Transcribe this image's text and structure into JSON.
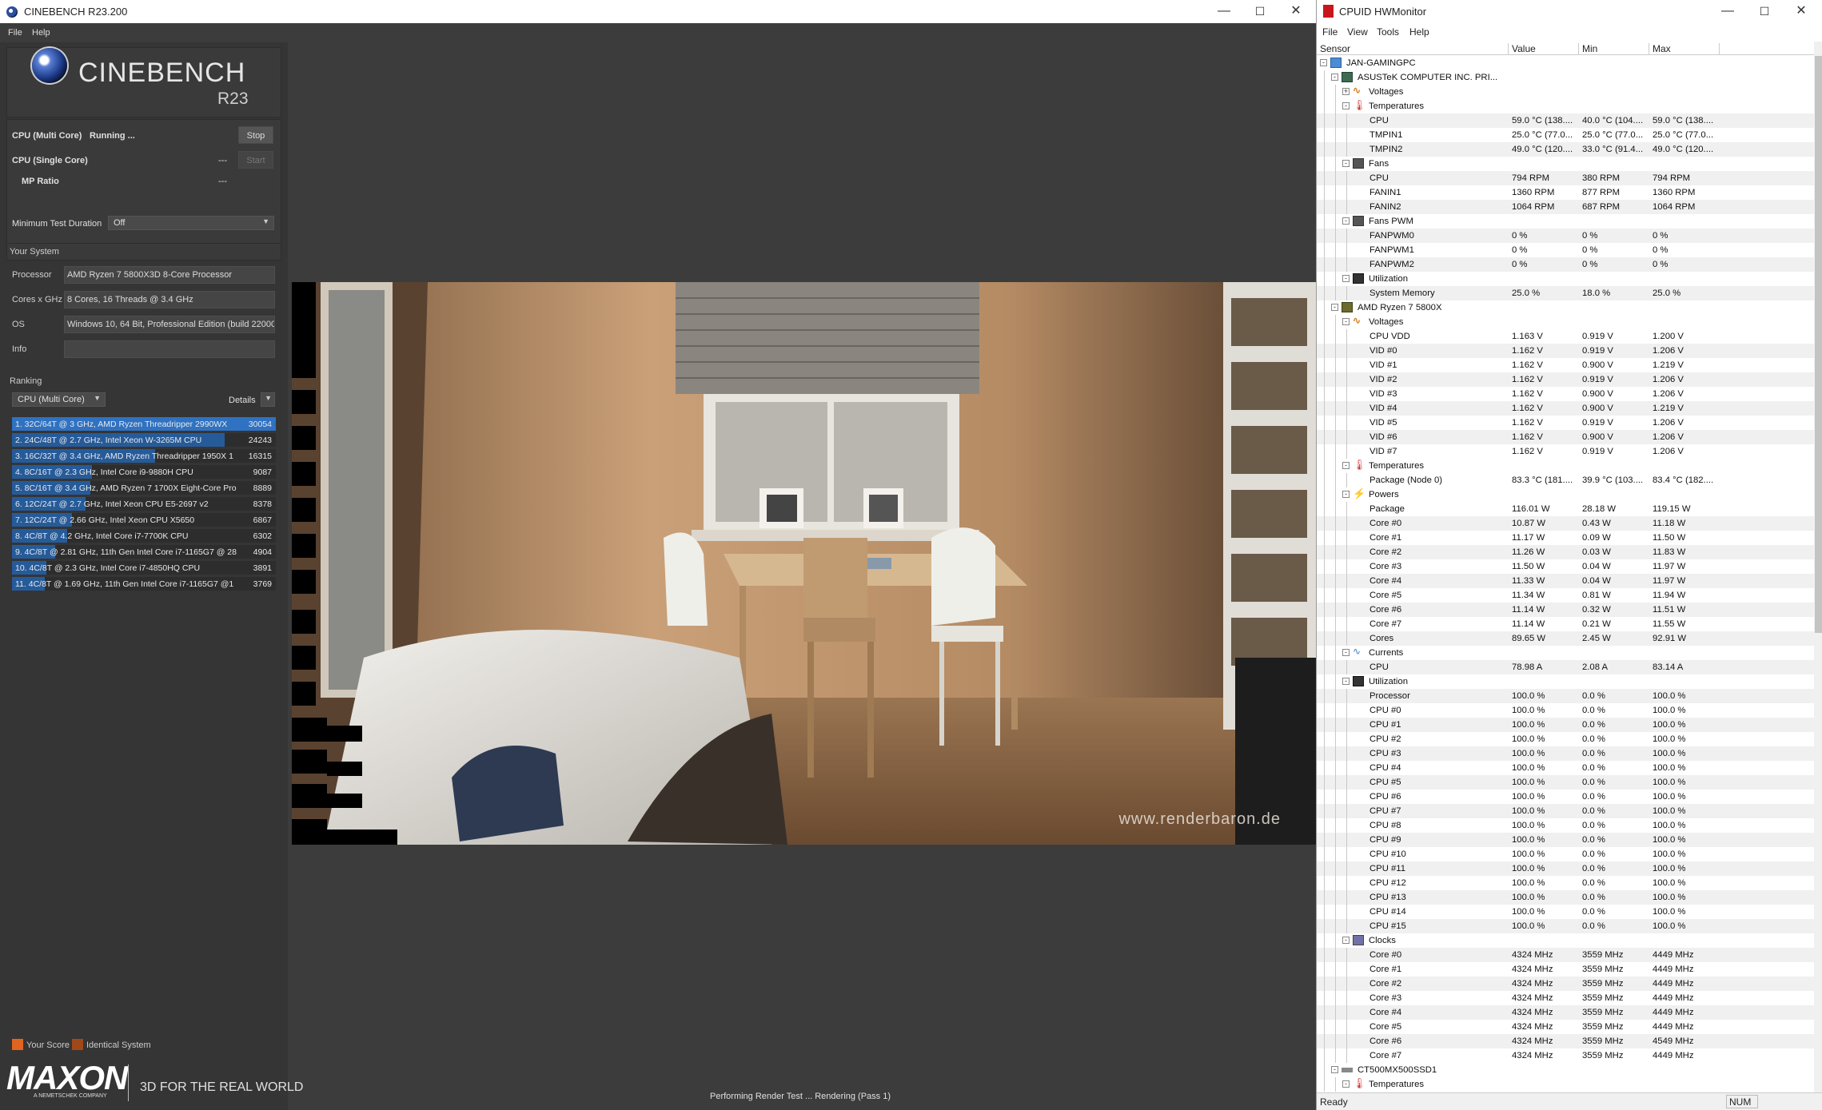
{
  "cinebench": {
    "window_title": "CINEBENCH R23.200",
    "menu": [
      "File",
      "Help"
    ],
    "brand_name": "CINEBENCH",
    "brand_version": "R23",
    "multi_core": {
      "label": "CPU (Multi Core)",
      "status": "Running ...",
      "button": "Stop"
    },
    "single_core": {
      "label": "CPU (Single Core)",
      "value": "---",
      "button": "Start"
    },
    "mp_ratio": {
      "label": "MP Ratio",
      "value": "---"
    },
    "min_duration": {
      "label": "Minimum Test Duration",
      "value": "Off"
    },
    "your_system": {
      "title": "Your System",
      "fields": [
        {
          "label": "Processor",
          "value": "AMD Ryzen 7 5800X3D 8-Core Processor"
        },
        {
          "label": "Cores x GHz",
          "value": "8 Cores, 16 Threads @ 3.4 GHz"
        },
        {
          "label": "OS",
          "value": "Windows 10, 64 Bit, Professional Edition (build 22000"
        },
        {
          "label": "Info",
          "value": ""
        }
      ]
    },
    "ranking": {
      "title": "Ranking",
      "mode": "CPU (Multi Core)",
      "details": "Details",
      "items": [
        {
          "text": "1. 32C/64T @ 3 GHz, AMD Ryzen Threadripper 2990WX",
          "score": "30054",
          "fill": 1.0
        },
        {
          "text": "2. 24C/48T @ 2.7 GHz, Intel Xeon W-3265M CPU",
          "score": "24243",
          "fill": 0.807
        },
        {
          "text": "3. 16C/32T @ 3.4 GHz, AMD Ryzen Threadripper 1950X 1",
          "score": "16315",
          "fill": 0.543
        },
        {
          "text": "4. 8C/16T @ 2.3 GHz, Intel Core i9-9880H CPU",
          "score": "9087",
          "fill": 0.302
        },
        {
          "text": "5. 8C/16T @ 3.4 GHz, AMD Ryzen 7 1700X Eight-Core Pro",
          "score": "8889",
          "fill": 0.296
        },
        {
          "text": "6. 12C/24T @ 2.7 GHz, Intel Xeon CPU E5-2697 v2",
          "score": "8378",
          "fill": 0.279
        },
        {
          "text": "7. 12C/24T @ 2.66 GHz, Intel Xeon CPU X5650",
          "score": "6867",
          "fill": 0.228
        },
        {
          "text": "8. 4C/8T @ 4.2 GHz, Intel Core i7-7700K CPU",
          "score": "6302",
          "fill": 0.21
        },
        {
          "text": "9. 4C/8T @ 2.81 GHz, 11th Gen Intel Core i7-1165G7 @ 28",
          "score": "4904",
          "fill": 0.163
        },
        {
          "text": "10. 4C/8T @ 2.3 GHz, Intel Core i7-4850HQ CPU",
          "score": "3891",
          "fill": 0.129
        },
        {
          "text": "11. 4C/8T @ 1.69 GHz, 11th Gen Intel Core i7-1165G7 @1",
          "score": "3769",
          "fill": 0.125
        }
      ]
    },
    "legend": {
      "your_score": "Your Score",
      "identical": "Identical System"
    },
    "footer": {
      "logo": "MAXON",
      "logo_sub": "A NEMETSCHEK COMPANY",
      "tagline": "3D FOR THE REAL WORLD"
    },
    "status": "Performing Render Test ... Rendering (Pass 1)",
    "watermark": "www.renderbaron.de",
    "colors": {
      "your_score": "#e0641e",
      "identical": "#a0481a",
      "bar": "#265b9a"
    }
  },
  "hwmonitor": {
    "window_title": "CPUID HWMonitor",
    "menu": [
      "File",
      "View",
      "Tools",
      "Help"
    ],
    "columns": [
      "Sensor",
      "Value",
      "Min",
      "Max"
    ],
    "rows": [
      {
        "l": 0,
        "t": "-",
        "i": "pc",
        "n": "JAN-GAMINGPC"
      },
      {
        "l": 1,
        "t": "-",
        "i": "mb",
        "n": "ASUSTeK COMPUTER INC. PRI..."
      },
      {
        "l": 2,
        "t": "+",
        "i": "vol",
        "n": "Voltages"
      },
      {
        "l": 2,
        "t": "-",
        "i": "tmp",
        "n": "Temperatures"
      },
      {
        "l": 3,
        "n": "CPU",
        "v": "59.0 °C  (138....",
        "mi": "40.0 °C  (104....",
        "ma": "59.0 °C  (138...."
      },
      {
        "l": 3,
        "n": "TMPIN1",
        "v": "25.0 °C  (77.0...",
        "mi": "25.0 °C  (77.0...",
        "ma": "25.0 °C  (77.0..."
      },
      {
        "l": 3,
        "n": "TMPIN2",
        "v": "49.0 °C  (120....",
        "mi": "33.0 °C  (91.4...",
        "ma": "49.0 °C  (120...."
      },
      {
        "l": 2,
        "t": "-",
        "i": "fan",
        "n": "Fans"
      },
      {
        "l": 3,
        "n": "CPU",
        "v": "794 RPM",
        "mi": "380 RPM",
        "ma": "794 RPM"
      },
      {
        "l": 3,
        "n": "FANIN1",
        "v": "1360 RPM",
        "mi": "877 RPM",
        "ma": "1360 RPM"
      },
      {
        "l": 3,
        "n": "FANIN2",
        "v": "1064 RPM",
        "mi": "687 RPM",
        "ma": "1064 RPM"
      },
      {
        "l": 2,
        "t": "-",
        "i": "fan",
        "n": "Fans PWM"
      },
      {
        "l": 3,
        "n": "FANPWM0",
        "v": "0 %",
        "mi": "0 %",
        "ma": "0 %"
      },
      {
        "l": 3,
        "n": "FANPWM1",
        "v": "0 %",
        "mi": "0 %",
        "ma": "0 %"
      },
      {
        "l": 3,
        "n": "FANPWM2",
        "v": "0 %",
        "mi": "0 %",
        "ma": "0 %"
      },
      {
        "l": 2,
        "t": "-",
        "i": "util",
        "n": "Utilization"
      },
      {
        "l": 3,
        "n": "System Memory",
        "v": "25.0 %",
        "mi": "18.0 %",
        "ma": "25.0 %"
      },
      {
        "l": 1,
        "t": "-",
        "i": "cpu",
        "n": "AMD Ryzen 7 5800X"
      },
      {
        "l": 2,
        "t": "-",
        "i": "vol",
        "n": "Voltages"
      },
      {
        "l": 3,
        "n": "CPU VDD",
        "v": "1.163 V",
        "mi": "0.919 V",
        "ma": "1.200 V"
      },
      {
        "l": 3,
        "n": "VID #0",
        "v": "1.162 V",
        "mi": "0.919 V",
        "ma": "1.206 V"
      },
      {
        "l": 3,
        "n": "VID #1",
        "v": "1.162 V",
        "mi": "0.900 V",
        "ma": "1.219 V"
      },
      {
        "l": 3,
        "n": "VID #2",
        "v": "1.162 V",
        "mi": "0.919 V",
        "ma": "1.206 V"
      },
      {
        "l": 3,
        "n": "VID #3",
        "v": "1.162 V",
        "mi": "0.900 V",
        "ma": "1.206 V"
      },
      {
        "l": 3,
        "n": "VID #4",
        "v": "1.162 V",
        "mi": "0.900 V",
        "ma": "1.219 V"
      },
      {
        "l": 3,
        "n": "VID #5",
        "v": "1.162 V",
        "mi": "0.919 V",
        "ma": "1.206 V"
      },
      {
        "l": 3,
        "n": "VID #6",
        "v": "1.162 V",
        "mi": "0.900 V",
        "ma": "1.206 V"
      },
      {
        "l": 3,
        "n": "VID #7",
        "v": "1.162 V",
        "mi": "0.919 V",
        "ma": "1.206 V"
      },
      {
        "l": 2,
        "t": "-",
        "i": "tmp",
        "n": "Temperatures"
      },
      {
        "l": 3,
        "n": "Package (Node 0)",
        "v": "83.3 °C  (181....",
        "mi": "39.9 °C  (103....",
        "ma": "83.4 °C  (182...."
      },
      {
        "l": 2,
        "t": "-",
        "i": "pow",
        "n": "Powers"
      },
      {
        "l": 3,
        "n": "Package",
        "v": "116.01 W",
        "mi": "28.18 W",
        "ma": "119.15 W"
      },
      {
        "l": 3,
        "n": "Core #0",
        "v": "10.87 W",
        "mi": "0.43 W",
        "ma": "11.18 W"
      },
      {
        "l": 3,
        "n": "Core #1",
        "v": "11.17 W",
        "mi": "0.09 W",
        "ma": "11.50 W"
      },
      {
        "l": 3,
        "n": "Core #2",
        "v": "11.26 W",
        "mi": "0.03 W",
        "ma": "11.83 W"
      },
      {
        "l": 3,
        "n": "Core #3",
        "v": "11.50 W",
        "mi": "0.04 W",
        "ma": "11.97 W"
      },
      {
        "l": 3,
        "n": "Core #4",
        "v": "11.33 W",
        "mi": "0.04 W",
        "ma": "11.97 W"
      },
      {
        "l": 3,
        "n": "Core #5",
        "v": "11.34 W",
        "mi": "0.81 W",
        "ma": "11.94 W"
      },
      {
        "l": 3,
        "n": "Core #6",
        "v": "11.14 W",
        "mi": "0.32 W",
        "ma": "11.51 W"
      },
      {
        "l": 3,
        "n": "Core #7",
        "v": "11.14 W",
        "mi": "0.21 W",
        "ma": "11.55 W"
      },
      {
        "l": 3,
        "n": "Cores",
        "v": "89.65 W",
        "mi": "2.45 W",
        "ma": "92.91 W"
      },
      {
        "l": 2,
        "t": "-",
        "i": "cur",
        "n": "Currents"
      },
      {
        "l": 3,
        "n": "CPU",
        "v": "78.98 A",
        "mi": "2.08 A",
        "ma": "83.14 A"
      },
      {
        "l": 2,
        "t": "-",
        "i": "util",
        "n": "Utilization"
      },
      {
        "l": 3,
        "n": "Processor",
        "v": "100.0 %",
        "mi": "0.0 %",
        "ma": "100.0 %"
      },
      {
        "l": 3,
        "n": "CPU #0",
        "v": "100.0 %",
        "mi": "0.0 %",
        "ma": "100.0 %"
      },
      {
        "l": 3,
        "n": "CPU #1",
        "v": "100.0 %",
        "mi": "0.0 %",
        "ma": "100.0 %"
      },
      {
        "l": 3,
        "n": "CPU #2",
        "v": "100.0 %",
        "mi": "0.0 %",
        "ma": "100.0 %"
      },
      {
        "l": 3,
        "n": "CPU #3",
        "v": "100.0 %",
        "mi": "0.0 %",
        "ma": "100.0 %"
      },
      {
        "l": 3,
        "n": "CPU #4",
        "v": "100.0 %",
        "mi": "0.0 %",
        "ma": "100.0 %"
      },
      {
        "l": 3,
        "n": "CPU #5",
        "v": "100.0 %",
        "mi": "0.0 %",
        "ma": "100.0 %"
      },
      {
        "l": 3,
        "n": "CPU #6",
        "v": "100.0 %",
        "mi": "0.0 %",
        "ma": "100.0 %"
      },
      {
        "l": 3,
        "n": "CPU #7",
        "v": "100.0 %",
        "mi": "0.0 %",
        "ma": "100.0 %"
      },
      {
        "l": 3,
        "n": "CPU #8",
        "v": "100.0 %",
        "mi": "0.0 %",
        "ma": "100.0 %"
      },
      {
        "l": 3,
        "n": "CPU #9",
        "v": "100.0 %",
        "mi": "0.0 %",
        "ma": "100.0 %"
      },
      {
        "l": 3,
        "n": "CPU #10",
        "v": "100.0 %",
        "mi": "0.0 %",
        "ma": "100.0 %"
      },
      {
        "l": 3,
        "n": "CPU #11",
        "v": "100.0 %",
        "mi": "0.0 %",
        "ma": "100.0 %"
      },
      {
        "l": 3,
        "n": "CPU #12",
        "v": "100.0 %",
        "mi": "0.0 %",
        "ma": "100.0 %"
      },
      {
        "l": 3,
        "n": "CPU #13",
        "v": "100.0 %",
        "mi": "0.0 %",
        "ma": "100.0 %"
      },
      {
        "l": 3,
        "n": "CPU #14",
        "v": "100.0 %",
        "mi": "0.0 %",
        "ma": "100.0 %"
      },
      {
        "l": 3,
        "n": "CPU #15",
        "v": "100.0 %",
        "mi": "0.0 %",
        "ma": "100.0 %"
      },
      {
        "l": 2,
        "t": "-",
        "i": "clk",
        "n": "Clocks"
      },
      {
        "l": 3,
        "n": "Core #0",
        "v": "4324 MHz",
        "mi": "3559 MHz",
        "ma": "4449 MHz"
      },
      {
        "l": 3,
        "n": "Core #1",
        "v": "4324 MHz",
        "mi": "3559 MHz",
        "ma": "4449 MHz"
      },
      {
        "l": 3,
        "n": "Core #2",
        "v": "4324 MHz",
        "mi": "3559 MHz",
        "ma": "4449 MHz"
      },
      {
        "l": 3,
        "n": "Core #3",
        "v": "4324 MHz",
        "mi": "3559 MHz",
        "ma": "4449 MHz"
      },
      {
        "l": 3,
        "n": "Core #4",
        "v": "4324 MHz",
        "mi": "3559 MHz",
        "ma": "4449 MHz"
      },
      {
        "l": 3,
        "n": "Core #5",
        "v": "4324 MHz",
        "mi": "3559 MHz",
        "ma": "4449 MHz"
      },
      {
        "l": 3,
        "n": "Core #6",
        "v": "4324 MHz",
        "mi": "3559 MHz",
        "ma": "4549 MHz"
      },
      {
        "l": 3,
        "n": "Core #7",
        "v": "4324 MHz",
        "mi": "3559 MHz",
        "ma": "4449 MHz"
      },
      {
        "l": 1,
        "t": "-",
        "i": "dsk",
        "n": "CT500MX500SSD1"
      },
      {
        "l": 2,
        "t": "-",
        "i": "tmp",
        "n": "Temperatures"
      }
    ],
    "status": "Ready",
    "num": "NUM"
  }
}
